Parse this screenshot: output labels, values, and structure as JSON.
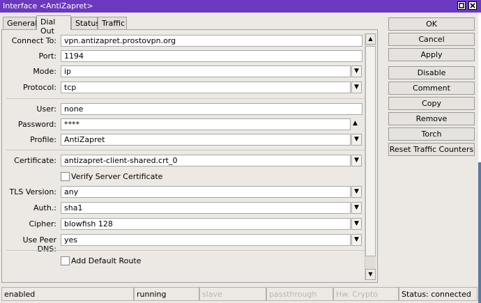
{
  "window": {
    "title": "Interface <AntiZapret>"
  },
  "tabs": [
    {
      "label": "General"
    },
    {
      "label": "Dial Out"
    },
    {
      "label": "Status"
    },
    {
      "label": "Traffic"
    }
  ],
  "form": {
    "connect_to": {
      "label": "Connect To:",
      "value": "vpn.antizapret.prostovpn.org"
    },
    "port": {
      "label": "Port:",
      "value": "1194"
    },
    "mode": {
      "label": "Mode:",
      "value": "ip"
    },
    "protocol": {
      "label": "Protocol:",
      "value": "tcp"
    },
    "user": {
      "label": "User:",
      "value": "none"
    },
    "password": {
      "label": "Password:",
      "value": "****"
    },
    "profile": {
      "label": "Profile:",
      "value": "AntiZapret"
    },
    "certificate": {
      "label": "Certificate:",
      "value": "antizapret-client-shared.crt_0"
    },
    "verify_server_certificate": {
      "label": "Verify Server Certificate",
      "checked": false
    },
    "tls_version": {
      "label": "TLS Version:",
      "value": "any"
    },
    "auth": {
      "label": "Auth.:",
      "value": "sha1"
    },
    "cipher": {
      "label": "Cipher:",
      "value": "blowfish 128"
    },
    "use_peer_dns": {
      "label": "Use Peer DNS:",
      "value": "yes"
    },
    "add_default_route": {
      "label": "Add Default Route",
      "checked": false
    }
  },
  "buttons": {
    "ok": "OK",
    "cancel": "Cancel",
    "apply": "Apply",
    "disable": "Disable",
    "comment": "Comment",
    "copy": "Copy",
    "remove": "Remove",
    "torch": "Torch",
    "reset_traffic_counters": "Reset Traffic Counters"
  },
  "status_bar": {
    "enabled": "enabled",
    "running": "running",
    "slave": "slave",
    "passthrough": "passthrough",
    "hw_crypto": "Hw. Crypto",
    "status": "Status: connected"
  },
  "icons": {
    "dropdown": "dropdown-arrow-icon",
    "password_toggle": "triangle-up-icon",
    "scroll_up": "scroll-up-icon",
    "scroll_down": "scroll-down-icon"
  },
  "colors": {
    "titlebar": "#6b38c0",
    "window_bg": "#ece9e4"
  }
}
